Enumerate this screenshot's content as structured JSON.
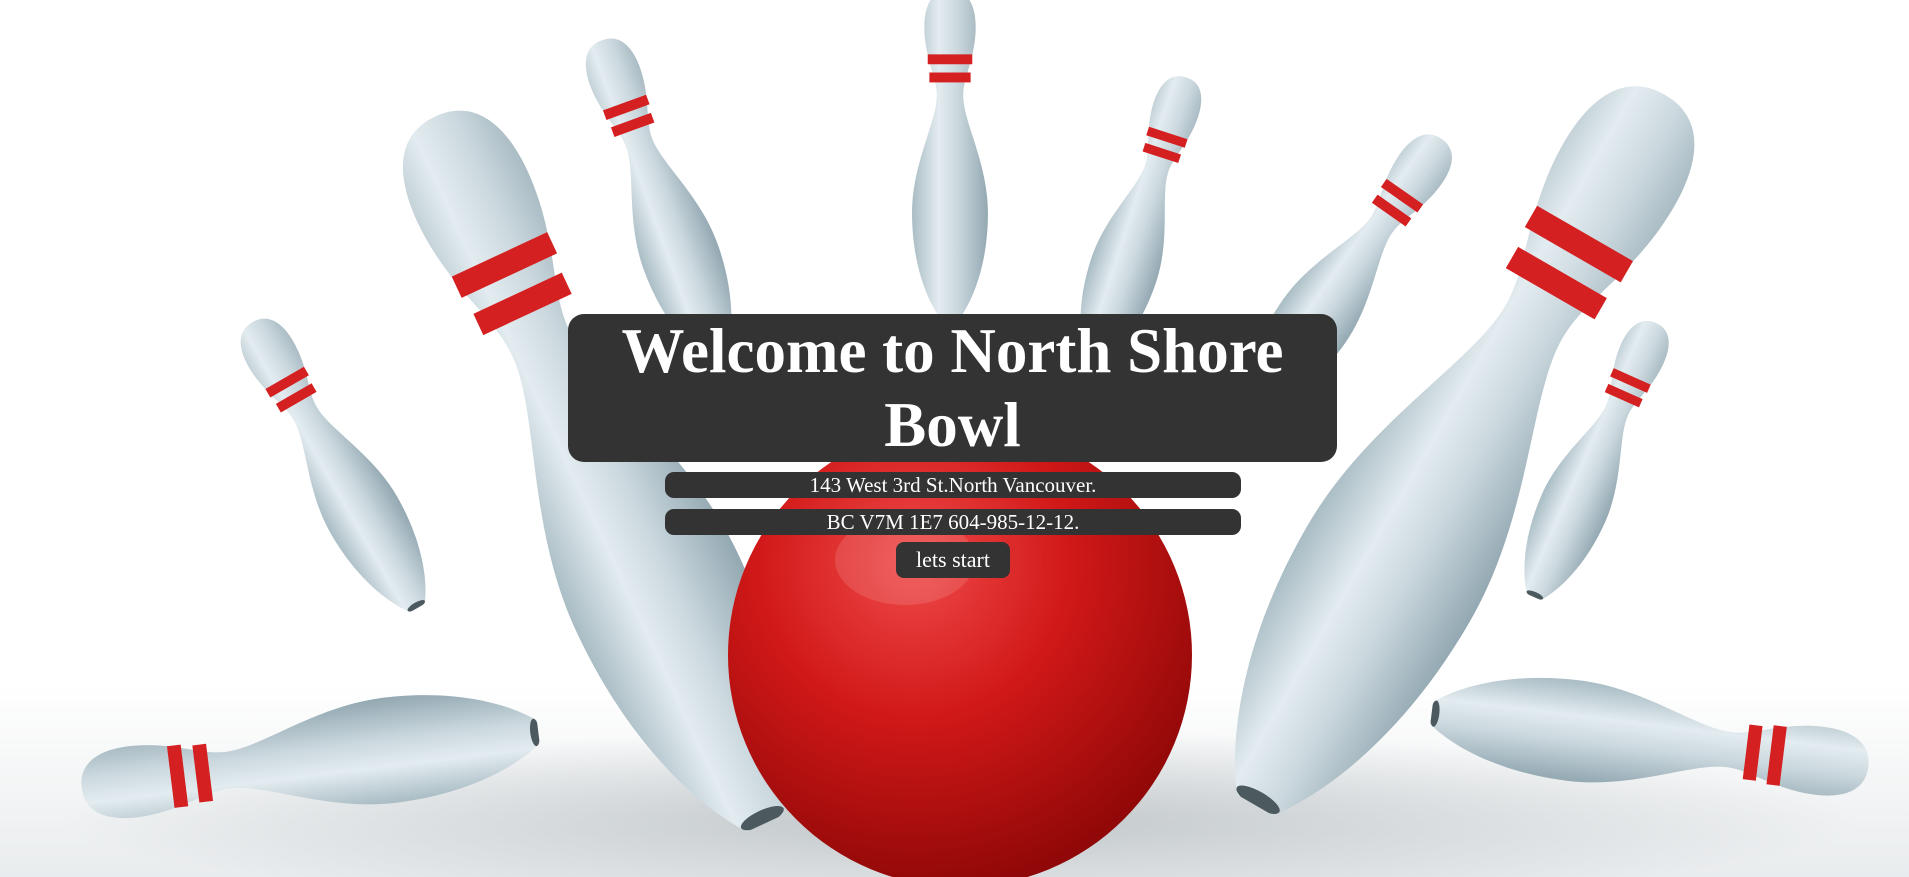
{
  "hero": {
    "title": "Welcome to North Shore Bowl",
    "address_line_1": "143 West 3rd St.North Vancouver.",
    "address_line_2": "BC V7M 1E7 604-985-12-12.",
    "cta_label": "lets start"
  },
  "background": {
    "subject": "bowling pins and red bowling ball",
    "pin_color": "#c9d6dc",
    "stripe_color": "#d42020",
    "ball_color": "#c41414",
    "panel_color": "#333333"
  }
}
